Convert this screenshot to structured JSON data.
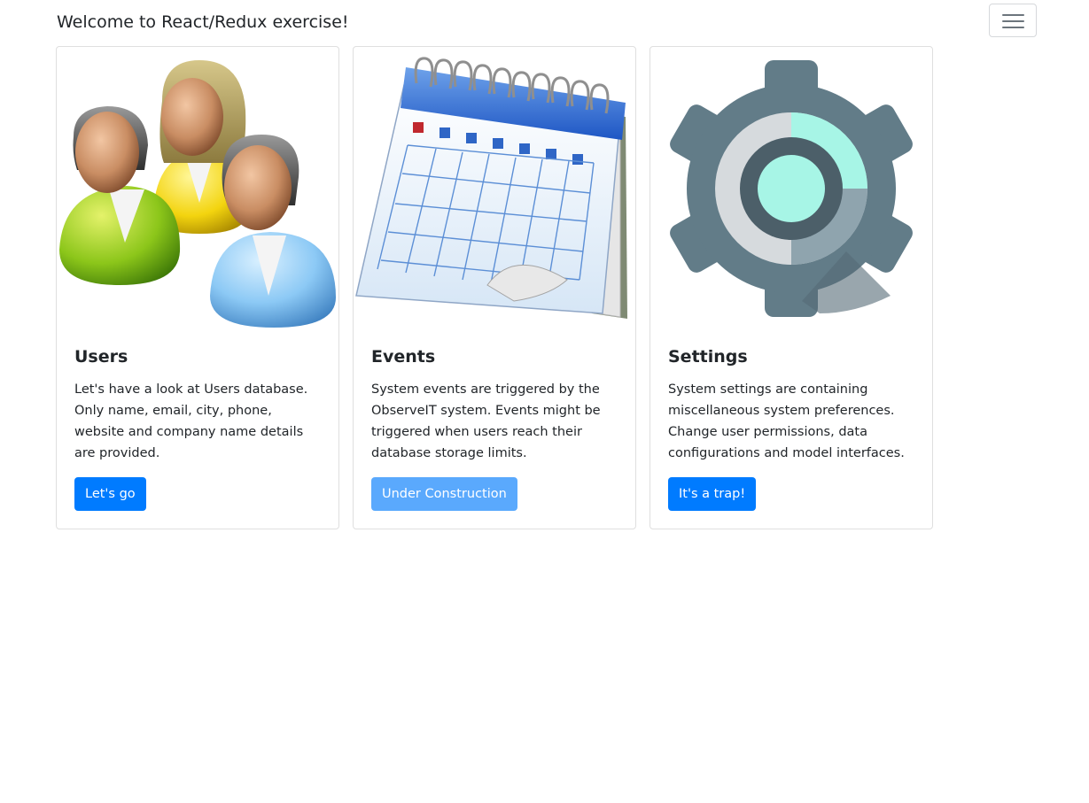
{
  "navbar": {
    "brand": "Welcome to React/Redux exercise!",
    "toggler_icon": "hamburger-menu-icon"
  },
  "cards": [
    {
      "image_icon": "users-group-icon",
      "title": "Users",
      "text": "Let's have a look at Users database. Only name, email, city, phone, website and company name details are provided.",
      "button_label": "Let's go",
      "button_disabled": false
    },
    {
      "image_icon": "calendar-icon",
      "title": "Events",
      "text": "System events are triggered by the ObserveIT system. Events might be triggered when users reach their database storage limits.",
      "button_label": "Under Construction",
      "button_disabled": true
    },
    {
      "image_icon": "settings-gear-icon",
      "title": "Settings",
      "text": "System settings are containing miscellaneous system preferences. Change user permissions, data configurations and model interfaces.",
      "button_label": "It's a trap!",
      "button_disabled": false
    }
  ],
  "colors": {
    "primary": "#007bff",
    "primary_disabled": "#5aa9fd",
    "gear": "#627c88",
    "gear_accent": "#a7f5e6"
  }
}
